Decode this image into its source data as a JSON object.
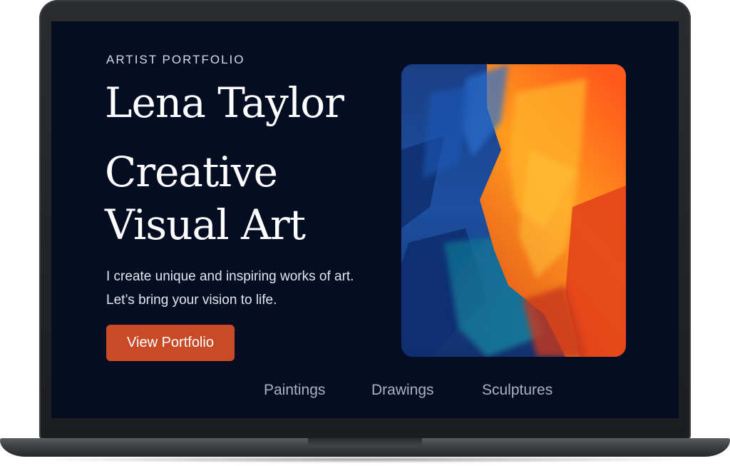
{
  "hero": {
    "eyebrow": "ARTIST PORTFOLIO",
    "name": "Lena Taylor",
    "headline_line1": "Creative",
    "headline_line2": "Visual Art",
    "tagline_line1": "I create unique and inspiring works of art.",
    "tagline_line2": "Let’s bring your vision to life.",
    "cta_label": "View Portfolio"
  },
  "nav": {
    "items": [
      "Paintings",
      "Drawings",
      "Sculptures"
    ]
  },
  "colors": {
    "background": "#050d22",
    "accent": "#c94a26",
    "text": "#ffffff",
    "nav_text": "#a9b1c2"
  }
}
